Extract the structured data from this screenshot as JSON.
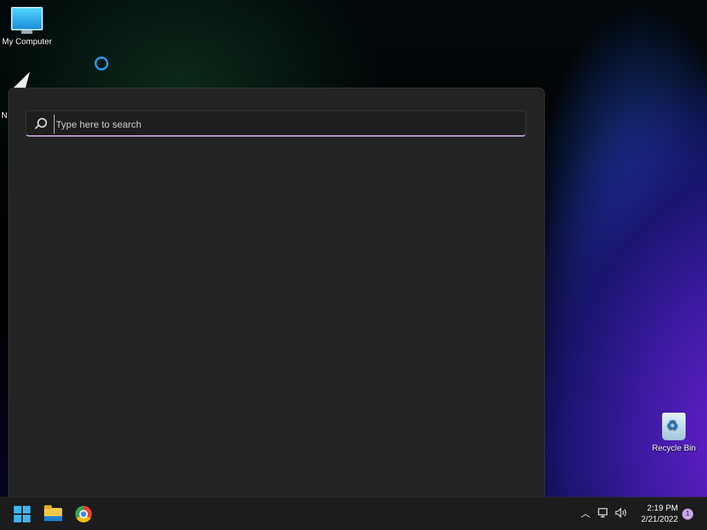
{
  "desktop": {
    "icons": [
      {
        "label": "My Computer",
        "icon": "my-computer-icon"
      },
      {
        "label": "N",
        "icon": "shortcut-triangle-icon"
      },
      {
        "label": "Recycle Bin",
        "icon": "recycle-bin-icon"
      }
    ]
  },
  "search_panel": {
    "placeholder": "Type here to search",
    "value": "",
    "accent_color": "#c9a7e8"
  },
  "taskbar": {
    "pinned": [
      {
        "name": "Start",
        "icon": "windows-logo-icon"
      },
      {
        "name": "File Explorer",
        "icon": "folder-icon"
      },
      {
        "name": "Google Chrome",
        "icon": "chrome-icon"
      }
    ],
    "tray": {
      "time": "2:19 PM",
      "date": "2/21/2022",
      "notification_count": "1"
    }
  }
}
